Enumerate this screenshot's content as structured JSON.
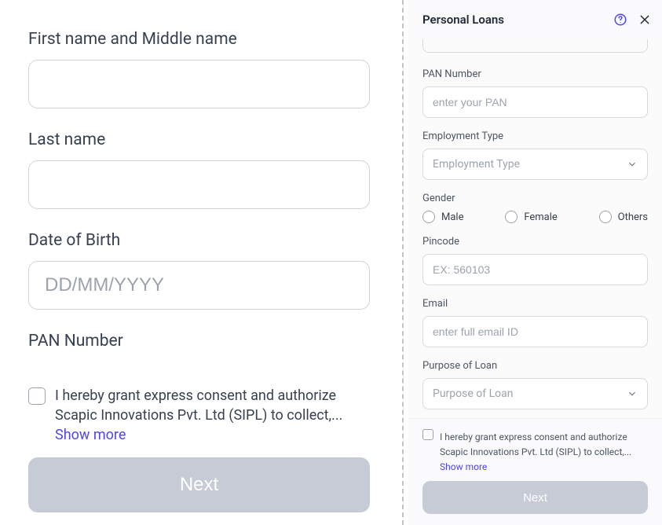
{
  "left": {
    "first_middle_label": "First name and Middle name",
    "last_name_label": "Last name",
    "dob_label": "Date of Birth",
    "dob_placeholder": "DD/MM/YYYY",
    "pan_label": "PAN Number",
    "consent_text": "I hereby grant express consent and authorize Scapic Innovations Pvt. Ltd (SIPL) to collect,...",
    "show_more": "Show more",
    "next": "Next"
  },
  "right": {
    "title": "Personal Loans",
    "pan_label": "PAN Number",
    "pan_placeholder": "enter your PAN",
    "employment_label": "Employment Type",
    "employment_placeholder": "Employment Type",
    "gender_label": "Gender",
    "gender_options": {
      "male": "Male",
      "female": "Female",
      "others": "Others"
    },
    "pincode_label": "Pincode",
    "pincode_placeholder": "EX: 560103",
    "email_label": "Email",
    "email_placeholder": "enter full email ID",
    "purpose_label": "Purpose of Loan",
    "purpose_placeholder": "Purpose of Loan",
    "consent_text": "I hereby grant express consent and authorize Scapic Innovations Pvt. Ltd (SIPL) to collect,...",
    "show_more": "Show more",
    "next": "Next"
  }
}
